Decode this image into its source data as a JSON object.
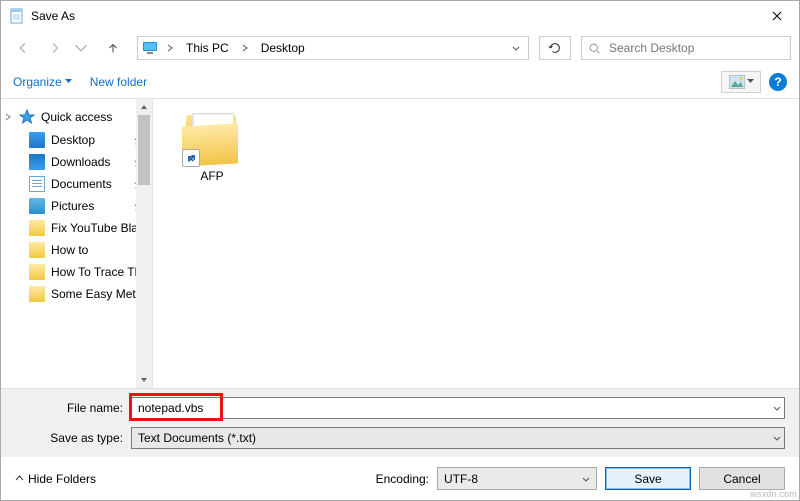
{
  "window": {
    "title": "Save As"
  },
  "nav": {
    "path": {
      "root": "This PC",
      "folder": "Desktop"
    },
    "search_placeholder": "Search Desktop"
  },
  "toolbar": {
    "organize": "Organize",
    "new_folder": "New folder"
  },
  "sidebar": {
    "quick_access": "Quick access",
    "items": [
      {
        "label": "Desktop",
        "pinned": true,
        "iconClass": "desktop-i"
      },
      {
        "label": "Downloads",
        "pinned": true,
        "iconClass": "down-i"
      },
      {
        "label": "Documents",
        "pinned": true,
        "iconClass": "doc-i"
      },
      {
        "label": "Pictures",
        "pinned": true,
        "iconClass": "pic-i"
      },
      {
        "label": "Fix YouTube Blac",
        "pinned": false,
        "iconClass": "folder-y"
      },
      {
        "label": "How to",
        "pinned": false,
        "iconClass": "folder-y"
      },
      {
        "label": "How To Trace Th",
        "pinned": false,
        "iconClass": "folder-y"
      },
      {
        "label": "Some Easy Meth",
        "pinned": false,
        "iconClass": "folder-y"
      }
    ]
  },
  "filepane": {
    "item1_label": "AFP"
  },
  "fields": {
    "filename_label": "File name:",
    "filename_value": "notepad.vbs",
    "saveas_label": "Save as type:",
    "saveas_value": "Text Documents (*.txt)"
  },
  "encoding": {
    "label": "Encoding:",
    "value": "UTF-8"
  },
  "actions": {
    "hide_folders": "Hide Folders",
    "save": "Save",
    "cancel": "Cancel"
  },
  "watermark": "wsxdn.com"
}
